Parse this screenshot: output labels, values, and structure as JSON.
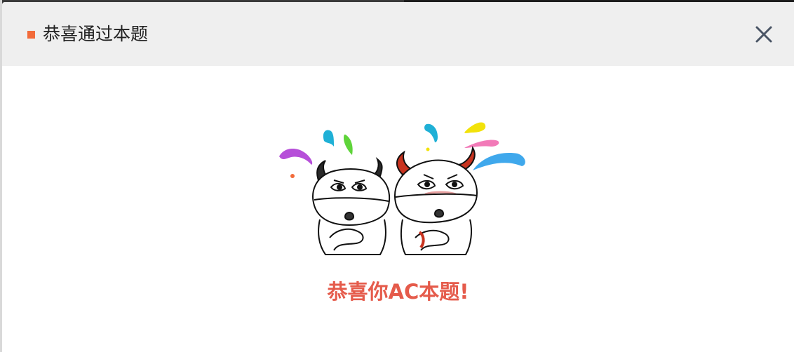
{
  "dialog": {
    "title": "恭喜通过本题",
    "close_icon": "close-icon",
    "message": "恭喜你AC本题!",
    "illustration": "two-cartoon-cows-celebrating",
    "colors": {
      "accent": "#f26b3a",
      "message": "#e55b4b",
      "header_bg": "#efefef"
    }
  }
}
